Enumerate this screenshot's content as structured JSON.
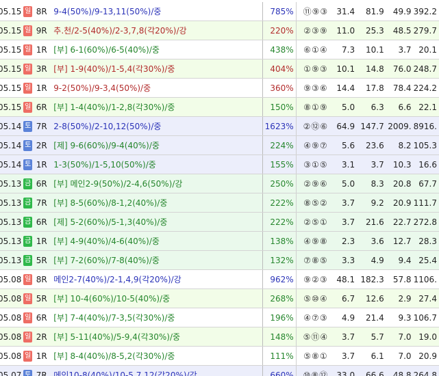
{
  "colors": {
    "day_sat": "#5b82d8",
    "day_fri": "#2fb84a",
    "day_sun": "#ee6d64",
    "text_green": "#26862d",
    "text_red": "#b22b2b",
    "text_blue": "#2b33b8"
  },
  "rows": [
    {
      "date": "05.15",
      "day": "일",
      "day_type": "sun",
      "race": "8R",
      "bet": "9-4(50%)/9-13,11(50%)/중",
      "bet_color": "blue",
      "ret": "785%",
      "result": "⑪⑨③",
      "n1": "31.4",
      "n2": "81.9",
      "n3": "49.9",
      "n4": "392.2",
      "bg": "white"
    },
    {
      "date": "05.15",
      "day": "일",
      "day_type": "sun",
      "race": "9R",
      "bet": "추.천/2-5(40%)/2-3,7,8(각20%)/강",
      "bet_color": "red",
      "ret": "220%",
      "result": "②③⑨",
      "n1": "11.0",
      "n2": "25.3",
      "n3": "48.5",
      "n4": "279.7",
      "bg": "green"
    },
    {
      "date": "05.15",
      "day": "일",
      "day_type": "sun",
      "race": "1R",
      "bet": "[부] 6-1(60%)/6-5(40%)/중",
      "bet_color": "green",
      "ret": "438%",
      "result": "⑥①④",
      "n1": "7.3",
      "n2": "10.1",
      "n3": "3.7",
      "n4": "20.1",
      "bg": "white"
    },
    {
      "date": "05.15",
      "day": "일",
      "day_type": "sun",
      "race": "3R",
      "bet": "[부] 1-9(40%)/1-5,4(각30%)/중",
      "bet_color": "red",
      "ret": "404%",
      "result": "①⑨③",
      "n1": "10.1",
      "n2": "14.8",
      "n3": "76.0",
      "n4": "248.7",
      "bg": "green"
    },
    {
      "date": "05.15",
      "day": "일",
      "day_type": "sun",
      "race": "1R",
      "bet": "9-2(50%)/9-3,4(50%)/중",
      "bet_color": "red",
      "ret": "360%",
      "result": "⑨③⑥",
      "n1": "14.4",
      "n2": "17.8",
      "n3": "78.4",
      "n4": "224.2",
      "bg": "white"
    },
    {
      "date": "05.15",
      "day": "일",
      "day_type": "sun",
      "race": "6R",
      "bet": "[부] 1-4(40%)/1-2,8(각30%)/중",
      "bet_color": "green",
      "ret": "150%",
      "result": "⑧①⑨",
      "n1": "5.0",
      "n2": "6.3",
      "n3": "6.6",
      "n4": "22.1",
      "bg": "green"
    },
    {
      "date": "05.14",
      "day": "토",
      "day_type": "sat",
      "race": "7R",
      "bet": "2-8(50%)/2-10,12(50%)/중",
      "bet_color": "blue",
      "ret": "1623%",
      "result": "②⑫⑥",
      "n1": "64.9",
      "n2": "147.7",
      "n3": "2009.",
      "n4": "8916.",
      "bg": "purple"
    },
    {
      "date": "05.14",
      "day": "토",
      "day_type": "sat",
      "race": "2R",
      "bet": "[제] 9-6(60%)/9-4(40%)/중",
      "bet_color": "green",
      "ret": "224%",
      "result": "④⑨⑦",
      "n1": "5.6",
      "n2": "23.6",
      "n3": "8.2",
      "n4": "105.3",
      "bg": "purple"
    },
    {
      "date": "05.14",
      "day": "토",
      "day_type": "sat",
      "race": "1R",
      "bet": "1-3(50%)/1-5,10(50%)/중",
      "bet_color": "green",
      "ret": "155%",
      "result": "③①⑤",
      "n1": "3.1",
      "n2": "3.7",
      "n3": "10.3",
      "n4": "16.6",
      "bg": "purple"
    },
    {
      "date": "05.13",
      "day": "금",
      "day_type": "fri",
      "race": "6R",
      "bet": "[부] 메인2-9(50%)/2-4,6(50%)/강",
      "bet_color": "green",
      "ret": "250%",
      "result": "②⑨⑥",
      "n1": "5.0",
      "n2": "8.3",
      "n3": "20.8",
      "n4": "67.7",
      "bg": "teal"
    },
    {
      "date": "05.13",
      "day": "금",
      "day_type": "fri",
      "race": "7R",
      "bet": "[부] 8-5(60%)/8-1,2(40%)/중",
      "bet_color": "green",
      "ret": "222%",
      "result": "⑧⑤②",
      "n1": "3.7",
      "n2": "9.2",
      "n3": "20.9",
      "n4": "111.7",
      "bg": "teal"
    },
    {
      "date": "05.13",
      "day": "금",
      "day_type": "fri",
      "race": "6R",
      "bet": "[제] 5-2(60%)/5-1,3(40%)/중",
      "bet_color": "green",
      "ret": "222%",
      "result": "②⑤①",
      "n1": "3.7",
      "n2": "21.6",
      "n3": "22.7",
      "n4": "272.8",
      "bg": "teal"
    },
    {
      "date": "05.13",
      "day": "금",
      "day_type": "fri",
      "race": "1R",
      "bet": "[부] 4-9(40%)/4-6(40%)/중",
      "bet_color": "green",
      "ret": "138%",
      "result": "④⑨⑧",
      "n1": "2.3",
      "n2": "3.6",
      "n3": "12.7",
      "n4": "28.3",
      "bg": "teal"
    },
    {
      "date": "05.13",
      "day": "금",
      "day_type": "fri",
      "race": "5R",
      "bet": "[부] 7-2(60%)/7-8(40%)/중",
      "bet_color": "green",
      "ret": "132%",
      "result": "⑦⑧⑤",
      "n1": "3.3",
      "n2": "4.9",
      "n3": "9.4",
      "n4": "25.4",
      "bg": "teal"
    },
    {
      "date": "05.08",
      "day": "일",
      "day_type": "sun",
      "race": "8R",
      "bet": "메인2-7(40%)/2-1,4,9(각20%)/강",
      "bet_color": "blue",
      "ret": "962%",
      "result": "⑨②③",
      "n1": "48.1",
      "n2": "182.3",
      "n3": "57.8",
      "n4": "1106.",
      "bg": "white"
    },
    {
      "date": "05.08",
      "day": "일",
      "day_type": "sun",
      "race": "5R",
      "bet": "[부] 10-4(60%)/10-5(40%)/중",
      "bet_color": "green",
      "ret": "268%",
      "result": "⑤⑩④",
      "n1": "6.7",
      "n2": "12.6",
      "n3": "2.9",
      "n4": "27.4",
      "bg": "green"
    },
    {
      "date": "05.08",
      "day": "일",
      "day_type": "sun",
      "race": "6R",
      "bet": "[부] 7-4(40%)/7-3,5(각30%)/중",
      "bet_color": "green",
      "ret": "196%",
      "result": "④⑦③",
      "n1": "4.9",
      "n2": "21.4",
      "n3": "9.3",
      "n4": "106.7",
      "bg": "white"
    },
    {
      "date": "05.08",
      "day": "일",
      "day_type": "sun",
      "race": "2R",
      "bet": "[부] 5-11(40%)/5-9,4(각30%)/중",
      "bet_color": "green",
      "ret": "148%",
      "result": "⑤⑪④",
      "n1": "3.7",
      "n2": "5.7",
      "n3": "7.0",
      "n4": "19.0",
      "bg": "green"
    },
    {
      "date": "05.08",
      "day": "일",
      "day_type": "sun",
      "race": "1R",
      "bet": "[부] 8-4(40%)/8-5,2(각30%)/중",
      "bet_color": "green",
      "ret": "111%",
      "result": "⑤⑧①",
      "n1": "3.7",
      "n2": "6.1",
      "n3": "7.0",
      "n4": "20.9",
      "bg": "white"
    },
    {
      "date": "05.07",
      "day": "토",
      "day_type": "sat",
      "race": "7R",
      "bet": "메인10-8(40%)/10-5,7,12(각20%)/강",
      "bet_color": "blue",
      "ret": "660%",
      "result": "⑩⑧⑫",
      "n1": "33.0",
      "n2": "66.6",
      "n3": "48.8",
      "n4": "264.8",
      "bg": "purple"
    }
  ]
}
